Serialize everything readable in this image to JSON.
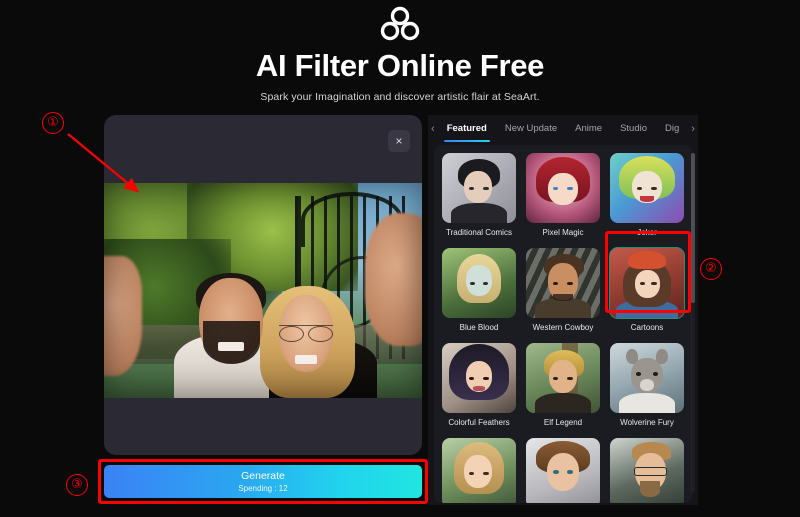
{
  "header": {
    "logo_icon": "three-circles-logo-icon",
    "title": "AI Filter Online Free",
    "subtitle": "Spark your Imagination and discover artistic flair at SeaArt."
  },
  "modal": {
    "close_label": "×",
    "close_icon": "close-icon",
    "photo_alt": "uploaded selfie photo of a couple outdoors"
  },
  "generate": {
    "label": "Generate",
    "spending": "Spending : 12",
    "gradient_start": "#3b82f6",
    "gradient_end": "#1fe6e0"
  },
  "styles_panel": {
    "prev_chevron": "‹",
    "next_chevron": "›",
    "tabs": [
      {
        "label": "Featured",
        "active": true
      },
      {
        "label": "New Update",
        "active": false
      },
      {
        "label": "Anime",
        "active": false
      },
      {
        "label": "Studio",
        "active": false
      },
      {
        "label": "Dig",
        "active": false
      }
    ],
    "selected_style": "Cartoons",
    "selection_color": "#2e8b74",
    "cards": [
      {
        "label": "Traditional Comics"
      },
      {
        "label": "Pixel Magic"
      },
      {
        "label": "Joker"
      },
      {
        "label": "Blue Blood"
      },
      {
        "label": "Western Cowboy"
      },
      {
        "label": "Cartoons"
      },
      {
        "label": "Colorful Feathers"
      },
      {
        "label": "Elf Legend"
      },
      {
        "label": "Wolverine Fury"
      },
      {
        "label": ""
      },
      {
        "label": ""
      },
      {
        "label": ""
      }
    ]
  },
  "annotations": {
    "color": "#ff0000",
    "marker1": "①",
    "marker2": "②",
    "marker3": "③"
  }
}
